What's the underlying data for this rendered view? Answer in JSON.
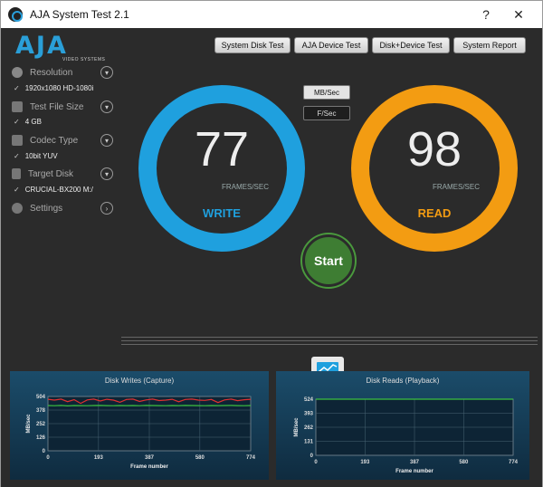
{
  "window": {
    "title": "AJA System Test 2.1",
    "help": "?",
    "close": "✕"
  },
  "logo": {
    "text": "AJA",
    "subtitle": "VIDEO SYSTEMS"
  },
  "sidebar": {
    "items": [
      {
        "label": "Resolution",
        "value": "1920x1080 HD-1080i"
      },
      {
        "label": "Test File Size",
        "value": "4 GB"
      },
      {
        "label": "Codec Type",
        "value": "10bit YUV"
      },
      {
        "label": "Target Disk",
        "value": "CRUCIAL-BX200 M:/"
      },
      {
        "label": "Settings",
        "value": ""
      }
    ]
  },
  "tabs": [
    "System Disk Test",
    "AJA Device Test",
    "Disk+Device Test",
    "System Report"
  ],
  "units": {
    "mbsec": "MB/Sec",
    "fsec": "F/Sec"
  },
  "write": {
    "value": "77",
    "unit": "FRAMES/SEC",
    "label": "WRITE",
    "color": "#1fa0de"
  },
  "read": {
    "value": "98",
    "unit": "FRAMES/SEC",
    "label": "READ",
    "color": "#f39c12"
  },
  "start_label": "Start",
  "chart_data": [
    {
      "type": "line",
      "title": "Disk Writes (Capture)",
      "xlabel": "Frame number",
      "ylabel": "MB/sec",
      "ylim": [
        0,
        504
      ],
      "yticks": [
        0,
        126,
        252,
        378,
        504
      ],
      "xticks": [
        0,
        193,
        387,
        580,
        774
      ],
      "series": [
        {
          "color": "#e03030",
          "values": [
            478,
            470,
            480,
            456,
            475,
            440,
            472,
            480,
            462,
            478,
            470,
            450,
            476,
            480,
            458,
            472,
            480,
            466,
            470,
            478,
            455,
            476,
            480,
            470,
            468,
            476,
            448,
            472,
            480,
            465,
            474,
            478
          ]
        },
        {
          "color": "#3cc040",
          "values": [
            420,
            418,
            421,
            417,
            420,
            419,
            418,
            420,
            421,
            419,
            418,
            420,
            419,
            420,
            418,
            421,
            420,
            419,
            418,
            420,
            419,
            421,
            420,
            419,
            418,
            420,
            419,
            420,
            421,
            419,
            418,
            420
          ]
        }
      ]
    },
    {
      "type": "line",
      "title": "Disk Reads (Playback)",
      "xlabel": "Frame number",
      "ylabel": "MB/sec",
      "ylim": [
        0,
        524
      ],
      "yticks": [
        0,
        131,
        262,
        393,
        524
      ],
      "xticks": [
        0,
        193,
        387,
        580,
        774
      ],
      "series": [
        {
          "color": "#3cc040",
          "values": [
            524,
            524,
            524,
            524,
            524,
            524,
            524,
            524,
            524,
            524,
            524,
            524,
            524,
            524,
            524,
            524,
            524,
            524,
            524,
            524,
            524,
            524,
            524,
            524,
            524,
            524,
            524,
            524,
            524,
            524,
            524,
            524
          ]
        }
      ]
    }
  ]
}
